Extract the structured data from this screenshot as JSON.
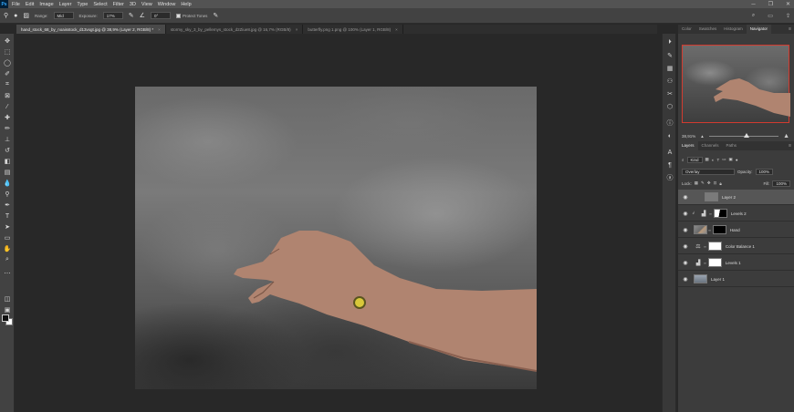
{
  "app": {
    "logo": "Ps"
  },
  "menu": [
    "File",
    "Edit",
    "Image",
    "Layer",
    "Type",
    "Select",
    "Filter",
    "3D",
    "View",
    "Window",
    "Help"
  ],
  "window_controls": {
    "minimize": "─",
    "restore": "❐",
    "close": "✕"
  },
  "options_bar": {
    "range_label": "Range:",
    "range_value": "Mid",
    "exposure_label": "Exposure:",
    "exposure_value": "17%",
    "angle_value": "0°",
    "protect_tones_label": "Protect Tones"
  },
  "tabs": [
    {
      "label": "hand_stock_68_by_noais­stock_d13vxgt.jpg @ 38,9% (Layer 2, RGB/8) *",
      "active": true
    },
    {
      "label": "stormy_sky_3_by_pellemys_stock_d2Ziue8.jpg @ 16,7% (RGB/8)",
      "active": false
    },
    {
      "label": "butterfly.png 1.png @ 100% (Layer 1, RGB/8)",
      "active": false
    }
  ],
  "panel_top": {
    "tabs": [
      "Color",
      "Swatches",
      "Histogram",
      "Navigator"
    ],
    "active": "Navigator",
    "zoom_value": "38,91%"
  },
  "layers_panel": {
    "tabs": [
      "Layers",
      "Channels",
      "Paths"
    ],
    "active": "Layers",
    "kind_label": "Kind",
    "blend_mode": "Overlay",
    "opacity_label": "Opacity:",
    "opacity_value": "100%",
    "lock_label": "Lock:",
    "fill_label": "Fill:",
    "fill_value": "100%",
    "layers": [
      {
        "name": "Layer 2",
        "selected": true,
        "thumb": "grey",
        "mask": null,
        "adj": ""
      },
      {
        "name": "Levels 2",
        "selected": false,
        "thumb": null,
        "mask": "mixed",
        "adj": "▟"
      },
      {
        "name": "Hand",
        "selected": false,
        "thumb": "photo",
        "mask": "black",
        "adj": ""
      },
      {
        "name": "Color Balance 1",
        "selected": false,
        "thumb": null,
        "mask": "white",
        "adj": "⚖"
      },
      {
        "name": "Levels 1",
        "selected": false,
        "thumb": null,
        "mask": "white",
        "adj": "▟"
      },
      {
        "name": "Layer 1",
        "selected": false,
        "thumb": "sky",
        "mask": null,
        "adj": ""
      }
    ]
  },
  "colors": {
    "accent_nav_border": "#d23b2f",
    "cursor": "#d8c83a"
  }
}
